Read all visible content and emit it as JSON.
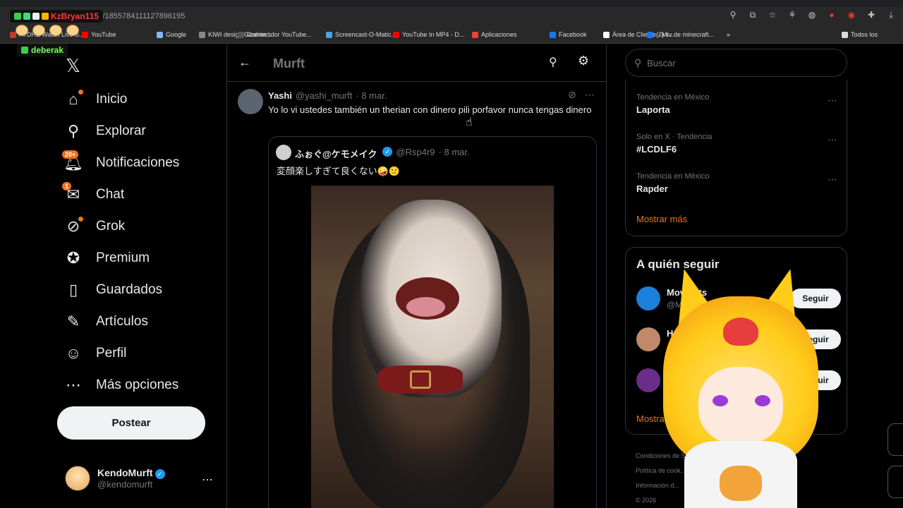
{
  "browser": {
    "url": "s/1855784111127896195",
    "bookmarks": [
      {
        "label": "ATDHE Watch Live S...",
        "color": "#c0392b"
      },
      {
        "label": "YouTube",
        "color": "#ff0000"
      },
      {
        "label": "Google",
        "color": "#8ab4f8"
      },
      {
        "label": "KIWI design Gestión...",
        "color": "#888888"
      },
      {
        "label": "Convertidor YouTube...",
        "color": "#555555"
      },
      {
        "label": "Screencast-O-Matic...",
        "color": "#4aa3df"
      },
      {
        "label": "YouTube In MP4 - D...",
        "color": "#ff0000"
      },
      {
        "label": "Aplicaciones",
        "color": "#ea4335"
      },
      {
        "label": "Facebook",
        "color": "#1877f2"
      },
      {
        "label": "Área de Cliente - Mi...",
        "color": "#ffffff"
      },
      {
        "label": "(2) sv de minecraft...",
        "color": "#1877f2"
      },
      {
        "label": "»",
        "color": ""
      },
      {
        "label": "Todos los",
        "color": "#dadce0"
      }
    ]
  },
  "stream_overlay": {
    "user1": "KzBryan115",
    "user2": "deberak"
  },
  "nav": {
    "logo": "𝕏",
    "items": [
      {
        "label": "Inicio",
        "icon": "home-icon",
        "glyph": "⌂",
        "badge": "dot"
      },
      {
        "label": "Explorar",
        "icon": "search-icon",
        "glyph": "⚲",
        "badge": ""
      },
      {
        "label": "Notificaciones",
        "icon": "bell-icon",
        "glyph": "🔔︎",
        "badge": "20+"
      },
      {
        "label": "Chat",
        "icon": "mail-icon",
        "glyph": "✉",
        "badge": "1"
      },
      {
        "label": "Grok",
        "icon": "grok-icon",
        "glyph": "⊘",
        "badge": "dot"
      },
      {
        "label": "Premium",
        "icon": "verified-icon",
        "glyph": "✪",
        "badge": ""
      },
      {
        "label": "Guardados",
        "icon": "bookmark-icon",
        "glyph": "▯",
        "badge": ""
      },
      {
        "label": "Artículos",
        "icon": "article-icon",
        "glyph": "✎",
        "badge": ""
      },
      {
        "label": "Perfil",
        "icon": "person-icon",
        "glyph": "☺",
        "badge": ""
      },
      {
        "label": "Más opciones",
        "icon": "more-circle-icon",
        "glyph": "⋯",
        "badge": ""
      }
    ],
    "post_button": "Postear",
    "account": {
      "name": "KendoMurft",
      "handle": "@kendomurft"
    }
  },
  "main": {
    "title": "Murft",
    "tweet": {
      "name": "Yashi",
      "handle": "@yashi_murft",
      "time": "· 8 mar.",
      "text": "Yo lo vi ustedes también un therian con dinero pili porfavor nunca tengas dinero"
    },
    "quote": {
      "name": "ふぉぐ@ケモメイク",
      "handle": "@Rsp4r9",
      "time": "· 8 mar.",
      "text": "変顔楽しすぎて良くない🤪🙁"
    }
  },
  "right": {
    "search_placeholder": "Buscar",
    "trends": [
      {
        "context": "Tendencia en México",
        "title": "Laporta"
      },
      {
        "context": "Solo en X · Tendencia",
        "title": "#LCDLF6"
      },
      {
        "context": "Tendencia en México",
        "title": "Rapder"
      }
    ],
    "show_more": "Mostrar más",
    "follow_title": "A quién seguir",
    "follow": [
      {
        "name": "Movi...rts",
        "handle": "@Mo",
        "button": "Seguir",
        "color": "#1b7fdc"
      },
      {
        "name": "H",
        "handle": "",
        "button": "Seguir",
        "color": "#c08a6a"
      },
      {
        "name": "",
        "handle": "",
        "button": "Seguir",
        "color": "#6a2d8a"
      }
    ],
    "follow_show_more": "Mostrar m",
    "footer": [
      "Condiciones de Ser...   ...dad  |",
      "Política de cook...",
      "Información d...",
      "© 2026"
    ]
  }
}
